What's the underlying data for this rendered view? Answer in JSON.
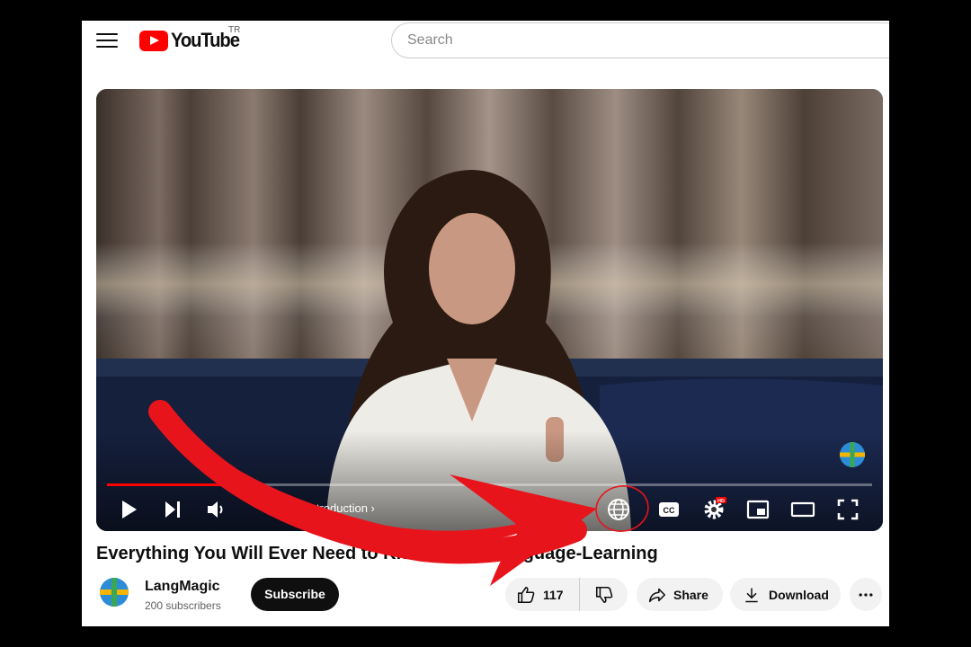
{
  "header": {
    "logo_text": "YouTube",
    "region": "TR",
    "search_placeholder": "Search"
  },
  "player": {
    "chapter_label": "Introduction ›",
    "progress_fraction": 0.17,
    "quality_badge": "HD",
    "cc_label": "CC"
  },
  "video": {
    "title": "Everything You Will Ever Need to Know about Language-Learning"
  },
  "channel": {
    "name": "LangMagic",
    "subscribers": "200 subscribers",
    "subscribe_label": "Subscribe"
  },
  "actions": {
    "like_count": "117",
    "share_label": "Share",
    "download_label": "Download"
  },
  "colors": {
    "brand_red": "#ff0000",
    "annotation_red": "#e8141c"
  },
  "icons": [
    "menu-icon",
    "youtube-logo-icon",
    "play-icon",
    "next-icon",
    "volume-icon",
    "globe-icon",
    "captions-icon",
    "settings-icon",
    "miniplayer-icon",
    "theater-icon",
    "fullscreen-icon",
    "like-icon",
    "dislike-icon",
    "share-icon",
    "download-icon",
    "more-icon"
  ]
}
